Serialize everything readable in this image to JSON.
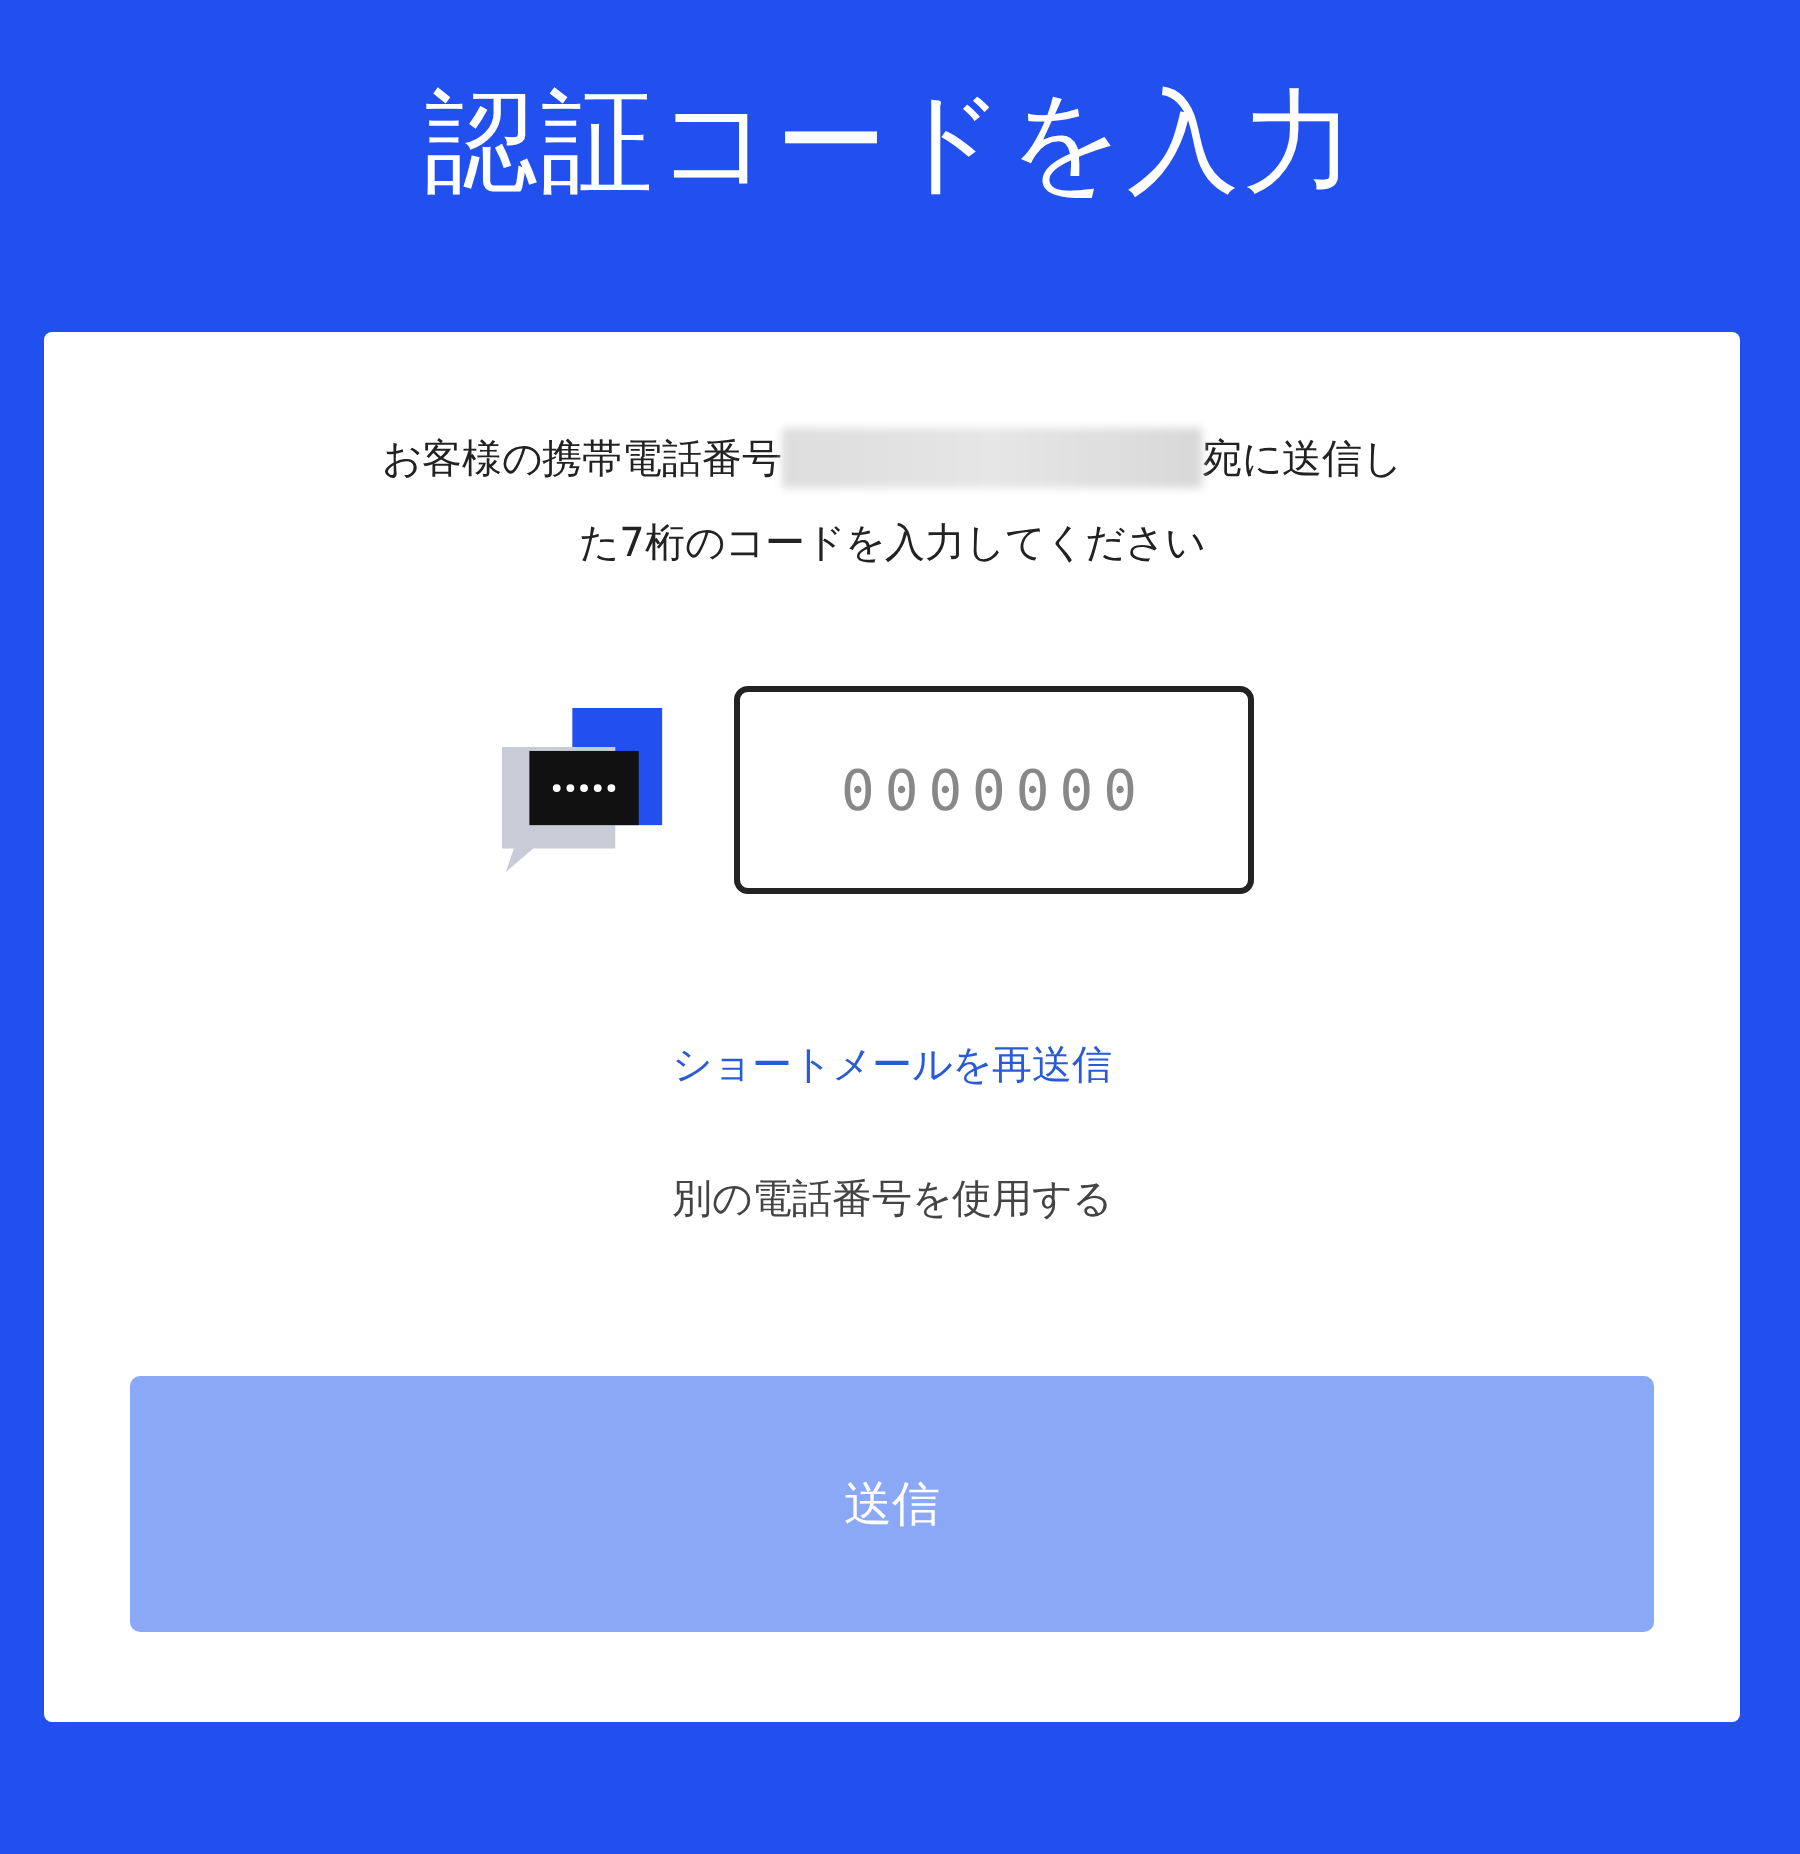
{
  "title": "認証コードを入力",
  "message": {
    "line_1_start": "お客様の携帯電話番号",
    "number_hidden": true,
    "line_1_end": "宛に送信し",
    "line_2": "た7桁のコードを入力してください"
  },
  "code_field": {
    "placeholder": "0000000"
  },
  "links": [
    {
      "label": "ショートメールを再送信",
      "kind": "primary"
    },
    {
      "label": "別の電話番号を使用する",
      "kind": "secondary"
    }
  ],
  "submit_button": {
    "label": "送信",
    "disabled": true
  }
}
